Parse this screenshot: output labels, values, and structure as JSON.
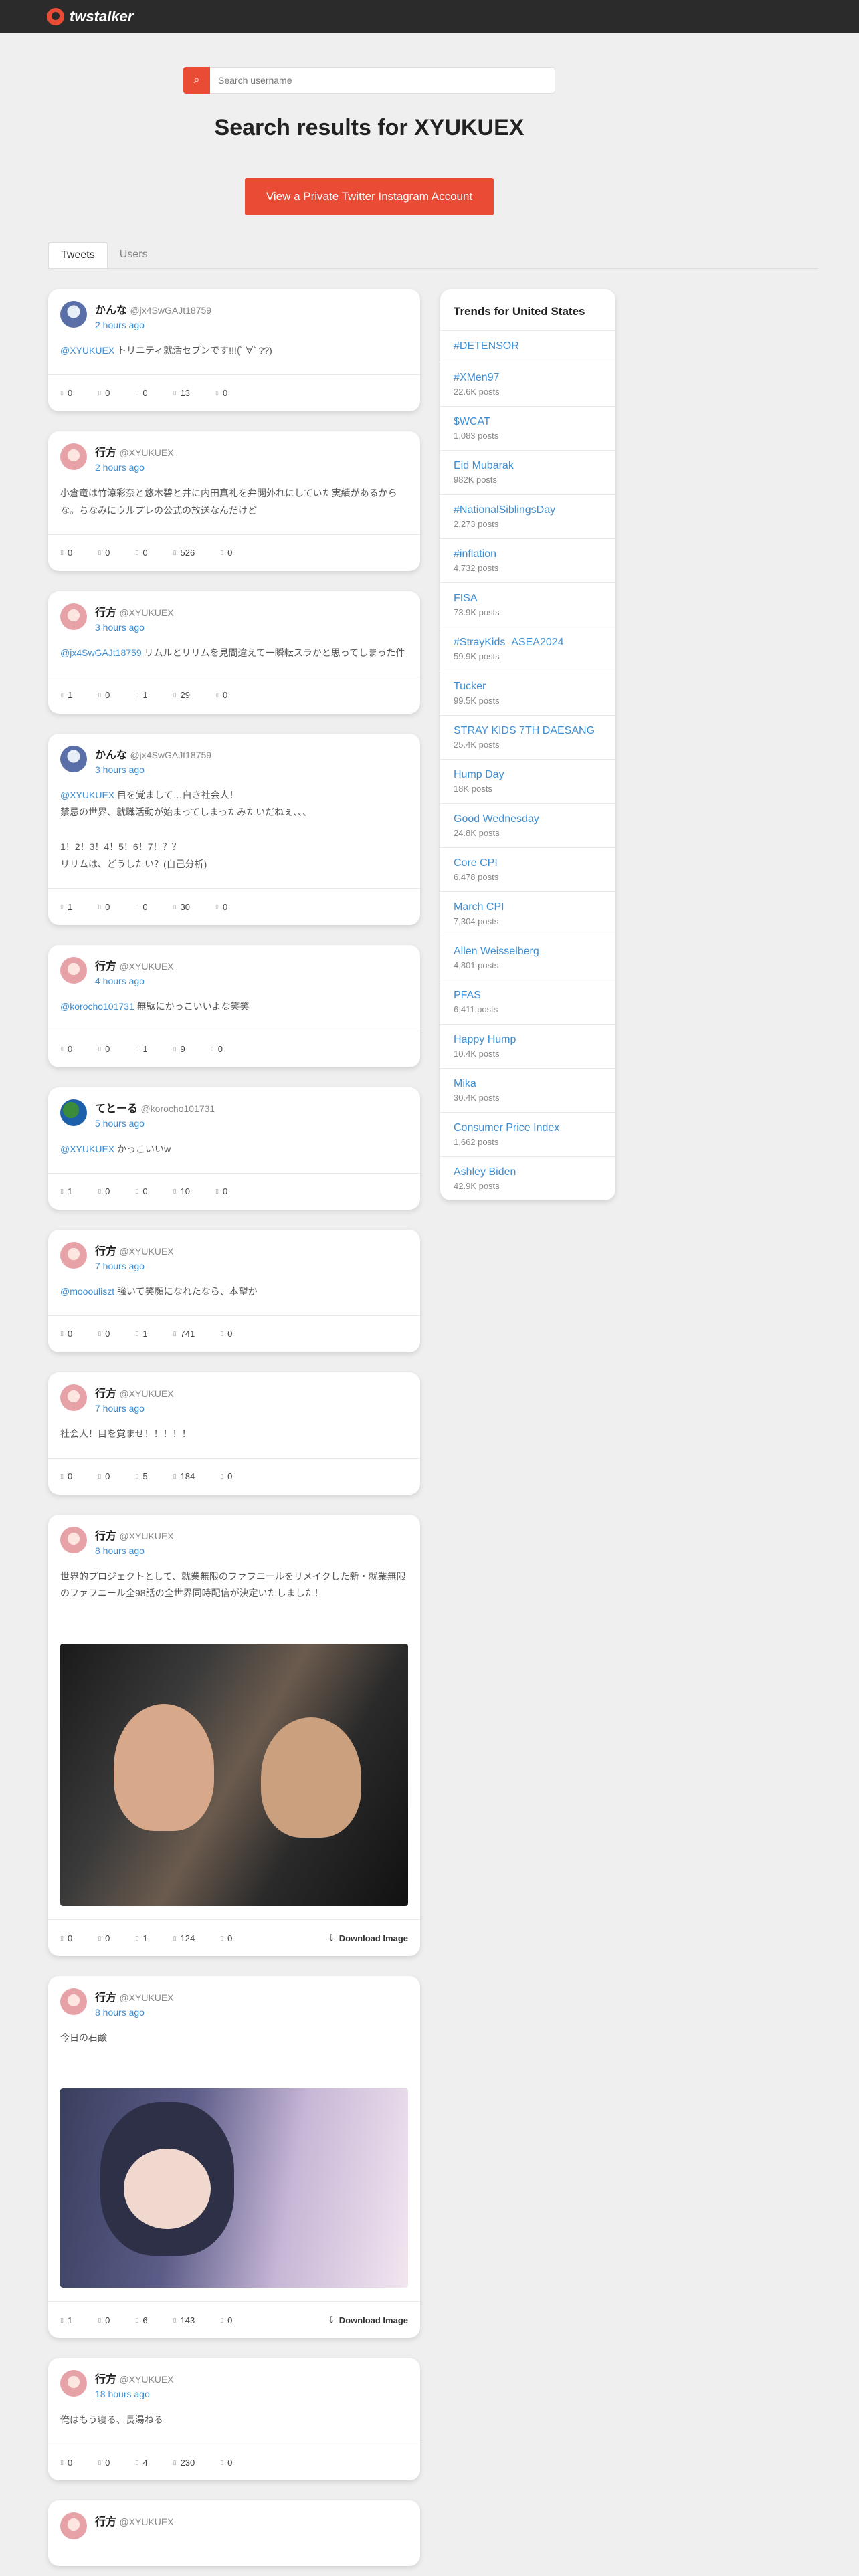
{
  "app": {
    "name": "twstalker"
  },
  "search": {
    "placeholder": "Search username",
    "button_icon": "search-icon"
  },
  "page_title": "Search results for XYUKUEX",
  "cta_label": "View a Private Twitter Instagram Account",
  "tabs": [
    {
      "label": "Tweets",
      "active": true
    },
    {
      "label": "Users",
      "active": false
    }
  ],
  "download_label": "Download Image",
  "tweets": [
    {
      "name": "かんな",
      "handle": "@jx4SwGAJt18759",
      "time": "2 hours ago",
      "mention": "@XYUKUEX",
      "text": " トリニティ就活セブンです!!!(ﾟ∀ﾟ??)",
      "stats": [
        "0",
        "0",
        "0",
        "13",
        "0"
      ]
    },
    {
      "name": "行方",
      "handle": "@XYUKUEX",
      "time": "2 hours ago",
      "mention": "",
      "text": "小倉竜は竹涼彩奈と悠木碧と井に内田真礼を弁閲外れにしていた実績があるからな。ちなみにウルプレの公式の放送なんだけど",
      "stats": [
        "0",
        "0",
        "0",
        "526",
        "0"
      ]
    },
    {
      "name": "行方",
      "handle": "@XYUKUEX",
      "time": "3 hours ago",
      "mention": "@jx4SwGAJt18759",
      "text": " リムルとリリムを見間違えて一瞬転スラかと思ってしまった件",
      "stats": [
        "1",
        "0",
        "1",
        "29",
        "0"
      ]
    },
    {
      "name": "かんな",
      "handle": "@jx4SwGAJt18759",
      "time": "3 hours ago",
      "mention": "@XYUKUEX",
      "text": " 目を覚まして…白き社会人！\n禁忌の世界、就職活動が始まってしまったみたいだねぇ、、、\n\n1！2！3！4！5！6！7！？？\nリリムは、どうしたい？(自己分析)",
      "stats": [
        "1",
        "0",
        "0",
        "30",
        "0"
      ]
    },
    {
      "name": "行方",
      "handle": "@XYUKUEX",
      "time": "4 hours ago",
      "mention": "@korocho101731",
      "text": " 無駄にかっこいいよな笑笑",
      "stats": [
        "0",
        "0",
        "1",
        "9",
        "0"
      ]
    },
    {
      "name": "てとーる",
      "handle": "@korocho101731",
      "time": "5 hours ago",
      "mention": "@XYUKUEX",
      "text": " かっこいいw",
      "stats": [
        "1",
        "0",
        "0",
        "10",
        "0"
      ]
    },
    {
      "name": "行方",
      "handle": "@XYUKUEX",
      "time": "7 hours ago",
      "mention": "@mooouliszt",
      "text": " 強いて笑顔になれたなら、本望か",
      "stats": [
        "0",
        "0",
        "1",
        "741",
        "0"
      ]
    },
    {
      "name": "行方",
      "handle": "@XYUKUEX",
      "time": "7 hours ago",
      "mention": "",
      "text": "社会人！目を覚ませ！！！！！",
      "stats": [
        "0",
        "0",
        "5",
        "184",
        "0"
      ]
    },
    {
      "name": "行方",
      "handle": "@XYUKUEX",
      "time": "8 hours ago",
      "mention": "",
      "text": "世界的プロジェクトとして、就業無限のファフニールをリメイクした新・就業無限のファフニール全98話の全世界同時配信が決定いたしました！",
      "stats": [
        "0",
        "0",
        "1",
        "124",
        "0"
      ],
      "image": true
    },
    {
      "name": "行方",
      "handle": "@XYUKUEX",
      "time": "8 hours ago",
      "mention": "",
      "text": "今日の石鹸",
      "stats": [
        "1",
        "0",
        "6",
        "143",
        "0"
      ],
      "image": true
    },
    {
      "name": "行方",
      "handle": "@XYUKUEX",
      "time": "18 hours ago",
      "mention": "",
      "text": "俺はもう寝る、長湯ねる",
      "stats": [
        "0",
        "0",
        "4",
        "230",
        "0"
      ]
    },
    {
      "name": "行方",
      "handle": "@XYUKUEX"
    }
  ],
  "trends": {
    "title": "Trends for United States",
    "items": [
      {
        "name": "#DETENSOR",
        "count": ""
      },
      {
        "name": "#XMen97",
        "count": "22.6K posts"
      },
      {
        "name": "$WCAT",
        "count": "1,083 posts"
      },
      {
        "name": "Eid Mubarak",
        "count": "982K posts"
      },
      {
        "name": "#NationalSiblingsDay",
        "count": "2,273 posts"
      },
      {
        "name": "#inflation",
        "count": "4,732 posts"
      },
      {
        "name": "FISA",
        "count": "73.9K posts"
      },
      {
        "name": "#StrayKids_ASEA2024",
        "count": "59.9K posts"
      },
      {
        "name": "Tucker",
        "count": "99.5K posts"
      },
      {
        "name": "STRAY KIDS 7TH DAESANG",
        "count": "25.4K posts"
      },
      {
        "name": "Hump Day",
        "count": "18K posts"
      },
      {
        "name": "Good Wednesday",
        "count": "24.8K posts"
      },
      {
        "name": "Core CPI",
        "count": "6,478 posts"
      },
      {
        "name": "March CPI",
        "count": "7,304 posts"
      },
      {
        "name": "Allen Weisselberg",
        "count": "4,801 posts"
      },
      {
        "name": "PFAS",
        "count": "6,411 posts"
      },
      {
        "name": "Happy Hump",
        "count": "10.4K posts"
      },
      {
        "name": "Mika",
        "count": "30.4K posts"
      },
      {
        "name": "Consumer Price Index",
        "count": "1,662 posts"
      },
      {
        "name": "Ashley Biden",
        "count": "42.9K posts"
      }
    ]
  },
  "colors": {
    "accent": "#e94b35",
    "link": "#3d8ed4",
    "topbar": "#2b2b2b",
    "background": "#efefef"
  }
}
